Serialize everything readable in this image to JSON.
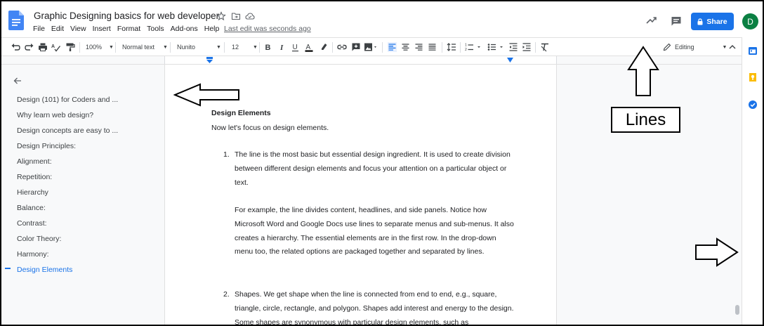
{
  "app": {
    "doc_title": "Graphic Designing basics for web developer",
    "menu": [
      "File",
      "Edit",
      "View",
      "Insert",
      "Format",
      "Tools",
      "Add-ons",
      "Help"
    ],
    "last_edit": "Last edit was seconds ago",
    "share_label": "Share",
    "avatar_letter": "D",
    "accent": "#1a73e8"
  },
  "toolbar": {
    "zoom": "100%",
    "style": "Normal text",
    "font": "Nunito",
    "size": "12",
    "mode": "Editing"
  },
  "outline": {
    "items": [
      {
        "label": "Design (101) for Coders and ..."
      },
      {
        "label": "Why learn web design?"
      },
      {
        "label": "Design concepts are easy to ..."
      },
      {
        "label": "Design Principles:"
      },
      {
        "label": "Alignment:"
      },
      {
        "label": "Repetition:"
      },
      {
        "label": "Hierarchy"
      },
      {
        "label": "Balance:"
      },
      {
        "label": "Contrast:"
      },
      {
        "label": "Color Theory:"
      },
      {
        "label": "Harmony:"
      },
      {
        "label": "Design Elements"
      }
    ],
    "active_index": 11
  },
  "document": {
    "heading": "Design Elements",
    "intro": "Now let's focus on design elements.",
    "item1_num": "1.",
    "item1_p1": "The line is the most basic but essential design ingredient. It is used to create division between different design elements and focus your attention on a particular object or text.",
    "item1_p2": "For example, the line divides content, headlines, and side panels. Notice how Microsoft Word and Google Docs use lines to separate menus and sub-menus. It also creates a hierarchy. The essential elements are in the first row. In the drop-down menu too, the related options are packaged together and separated by lines.",
    "item2_num": "2.",
    "item2_p1": "Shapes. We get shape when the line is connected from end to end, e.g., square, triangle, circle, rectangle, and polygon. Shapes add interest and energy to the design. Some shapes are synonymous with particular design elements, such as"
  },
  "annotation": {
    "callout": "Lines"
  }
}
